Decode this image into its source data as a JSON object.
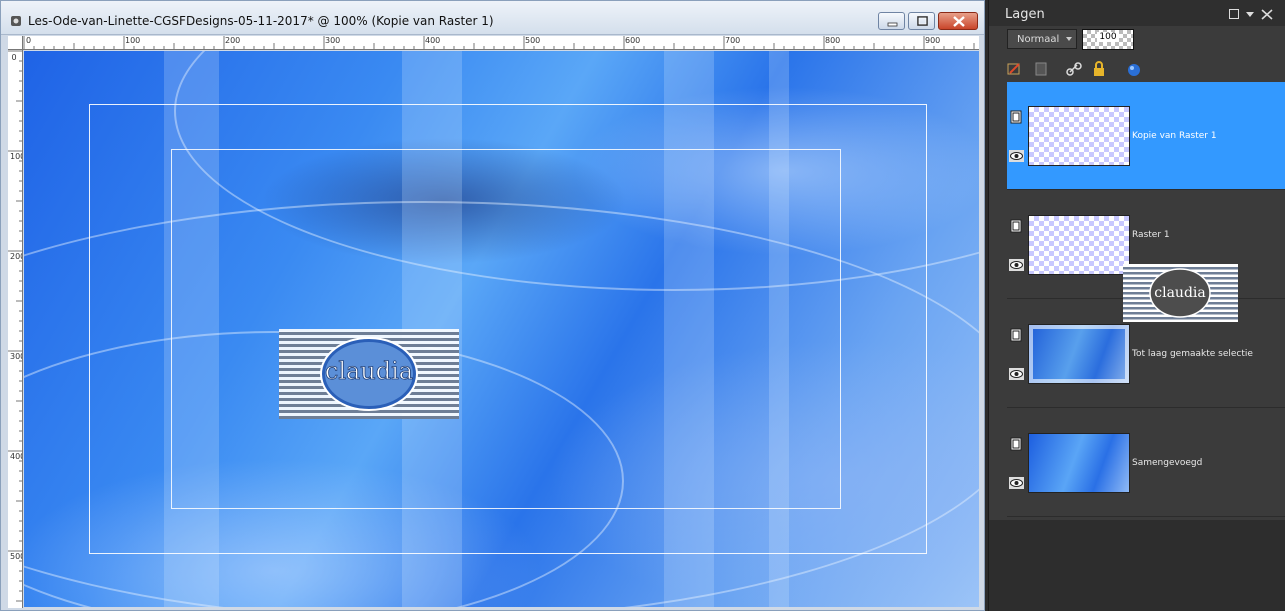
{
  "window": {
    "title": "Les-Ode-van-Linette-CGSFDesigns-05-11-2017* @ 100% (Kopie van Raster 1)",
    "buttons": [
      "minimize-icon",
      "maximize-icon",
      "close-icon"
    ]
  },
  "ruler": {
    "top_labels": [
      "0",
      "100",
      "200",
      "300",
      "400",
      "500",
      "600",
      "700",
      "800",
      "900"
    ],
    "left_labels": [
      "0",
      "100",
      "200",
      "300",
      "400",
      "500"
    ]
  },
  "canvas": {
    "watermark_text": "claudia",
    "colors": {
      "primary": "#2a74ea",
      "light": "#9cc4f7",
      "dark": "#1f4fb0"
    }
  },
  "layers_panel": {
    "title": "Lagen",
    "blend_mode": "Normaal",
    "opacity": "100",
    "tool_icons": [
      "paint-brush-icon",
      "mask-icon",
      "link-icon",
      "lock-icon",
      "blue-sphere-icon"
    ],
    "layers": [
      {
        "name": "Kopie van Raster 1",
        "selected": true,
        "thumb": "transparent"
      },
      {
        "name": "Raster 1",
        "selected": false,
        "thumb": "transparent"
      },
      {
        "name": "Tot laag gemaakte selectie",
        "selected": false,
        "thumb": "blue-framed"
      },
      {
        "name": "Samengevoegd",
        "selected": false,
        "thumb": "blue"
      }
    ],
    "selection_color": "#3399ff"
  }
}
